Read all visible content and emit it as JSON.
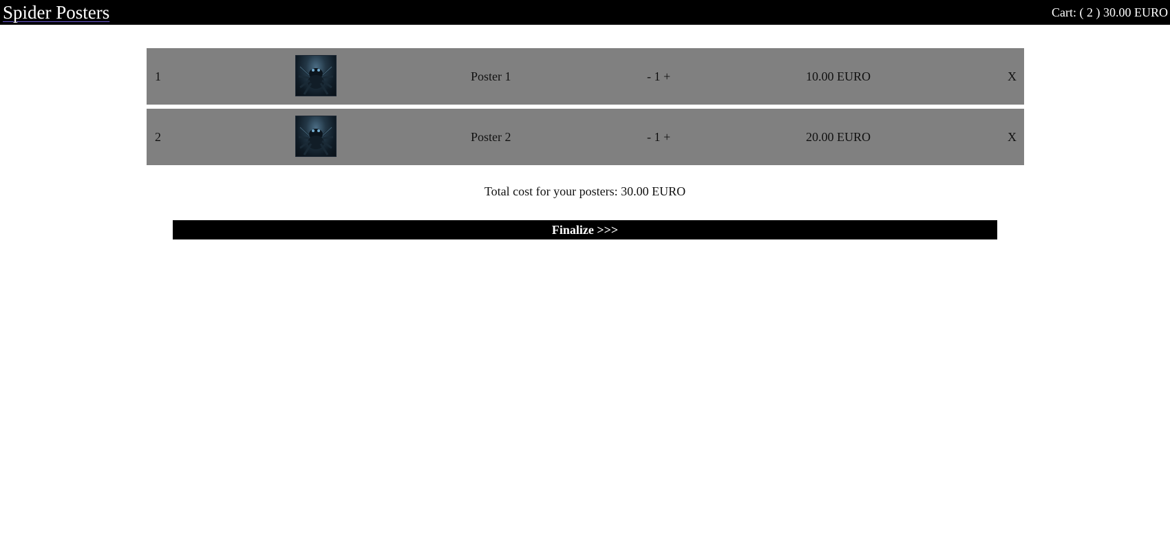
{
  "header": {
    "brand": "Spider Posters",
    "cart_summary": "Cart: ( 2 ) 30.00 EURO"
  },
  "cart": {
    "items": [
      {
        "index": "1",
        "thumbnail_icon": "spider-image",
        "name": "Poster 1",
        "quantity_control": "- 1 +",
        "price": "10.00 EURO",
        "remove": "X"
      },
      {
        "index": "2",
        "thumbnail_icon": "spider-image",
        "name": "Poster 2",
        "quantity_control": "- 1 +",
        "price": "20.00 EURO",
        "remove": "X"
      }
    ],
    "total_text": "Total cost for your posters: 30.00 EURO"
  },
  "actions": {
    "finalize_label": "Finalize >>>"
  },
  "colors": {
    "header_bg": "#000000",
    "row_bg": "#808080",
    "button_bg": "#000000"
  }
}
